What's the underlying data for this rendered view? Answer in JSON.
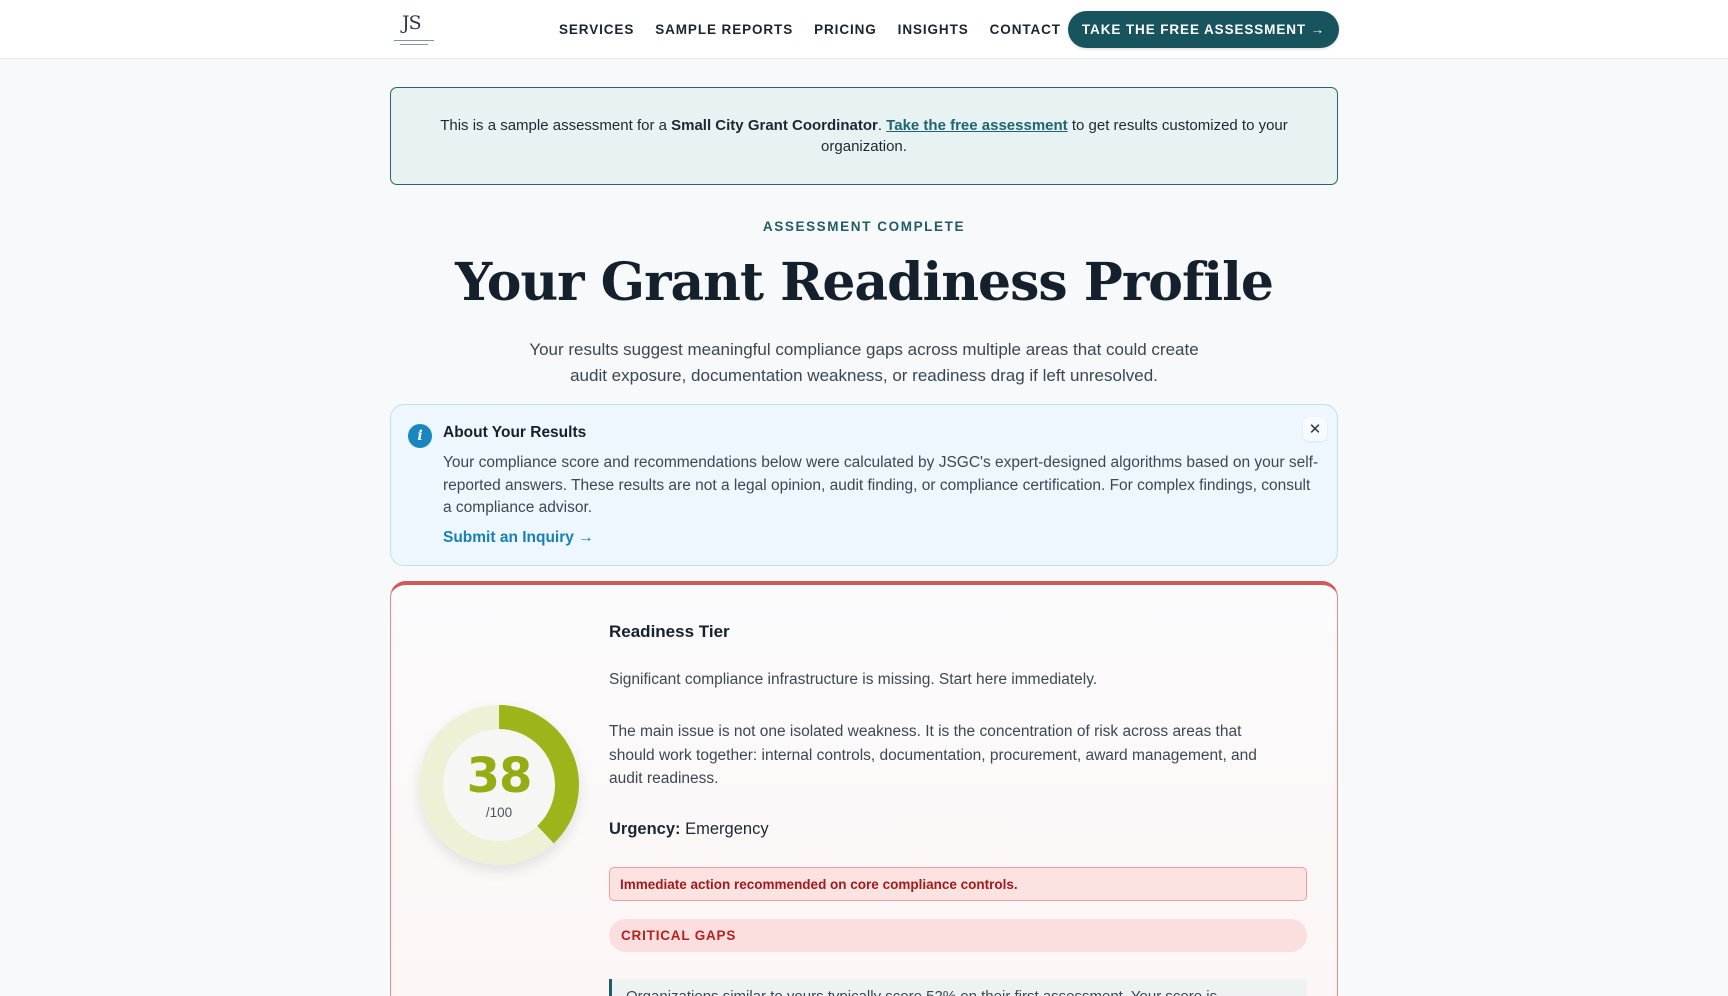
{
  "nav": {
    "logo_text": "JS",
    "links": [
      "SERVICES",
      "SAMPLE REPORTS",
      "PRICING",
      "INSIGHTS",
      "CONTACT"
    ],
    "cta_label": "TAKE THE FREE ASSESSMENT →"
  },
  "sample_banner": {
    "prefix": "This is a sample assessment for a ",
    "role": "Small City Grant Coordinator",
    "mid": ". ",
    "link": "Take the free assessment",
    "suffix": " to get results customized to your organization."
  },
  "eyebrow": "ASSESSMENT COMPLETE",
  "title": "Your Grant Readiness Profile",
  "subtitle": "Your results suggest meaningful compliance gaps across multiple areas that could create audit exposure, documentation weakness, or readiness drag if left unresolved.",
  "info": {
    "icon": "info-icon",
    "title": "About Your Results",
    "body": "Your compliance score and recommendations below were calculated by JSGC's expert-designed algorithms based on your self-reported answers. These results are not a legal opinion, audit finding, or compliance certification. For complex findings, consult a compliance advisor.",
    "link": "Submit an Inquiry →",
    "close": "✕"
  },
  "result": {
    "score": "38",
    "score_max": "/100",
    "score_fraction": 0.38,
    "colors": {
      "score": "#97ab13",
      "track": "#eef1d6",
      "card_border": "#d05a5a"
    },
    "tier_label": "Readiness Tier",
    "tier_desc": "Significant compliance infrastructure is missing. Start here immediately.",
    "tier_body": "The main issue is not one isolated weakness. It is the concentration of risk across areas that should work together: internal controls, documentation, procurement, award management, and audit readiness.",
    "urgency_label": "Urgency:",
    "urgency_value": "Emergency",
    "alert": "Immediate action recommended on core compliance controls.",
    "gaps_label": "CRITICAL GAPS",
    "note": "Organizations similar to yours typically score 52% on their first assessment. Your score is"
  }
}
